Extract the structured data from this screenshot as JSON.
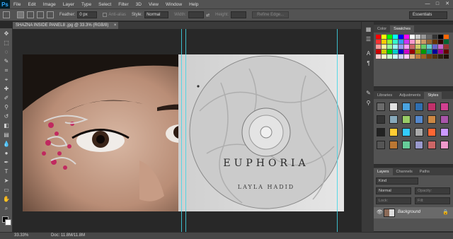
{
  "app": {
    "logo": "Ps"
  },
  "menu": [
    "File",
    "Edit",
    "Image",
    "Layer",
    "Type",
    "Select",
    "Filter",
    "3D",
    "View",
    "Window",
    "Help"
  ],
  "window_controls": {
    "minimize": "—",
    "maximize": "□",
    "close": "✕"
  },
  "options": {
    "feather_label": "Feather:",
    "feather_value": "0 px",
    "antialias_label": "Anti-alias",
    "style_label": "Style:",
    "style_value": "Normal",
    "width_label": "Width:",
    "height_label": "Height:",
    "refine_edge_label": "Refine Edge...",
    "workspace": "Essentials"
  },
  "document": {
    "tab_title": "SHAZNA INSIDE PANEL8 .jpg @ 33.3% (RGB/8)",
    "tab_close": "×",
    "artwork_title": "EUPHORIA",
    "artwork_subtitle": "LAYLA HADID"
  },
  "status": {
    "zoom": "33.33%",
    "doc_info": "Doc: 11.8M/11.8M"
  },
  "panels": {
    "color_tab": "Color",
    "swatches_tab": "Swatches",
    "libraries_tab": "Libraries",
    "adjustments_tab": "Adjustments",
    "styles_tab": "Styles",
    "layers_tab": "Layers",
    "channels_tab": "Channels",
    "paths_tab": "Paths",
    "kind_filter": "Kind",
    "blend_mode": "Normal",
    "opacity_label": "Opacity:",
    "lock_label": "Lock:",
    "fill_label": "Fill:",
    "layer_name": "Background"
  },
  "colors": {
    "chrome": "#535353",
    "canvas_bg": "#282828",
    "guide": "#3fd6e6",
    "ps_blue": "#31a8ff"
  }
}
